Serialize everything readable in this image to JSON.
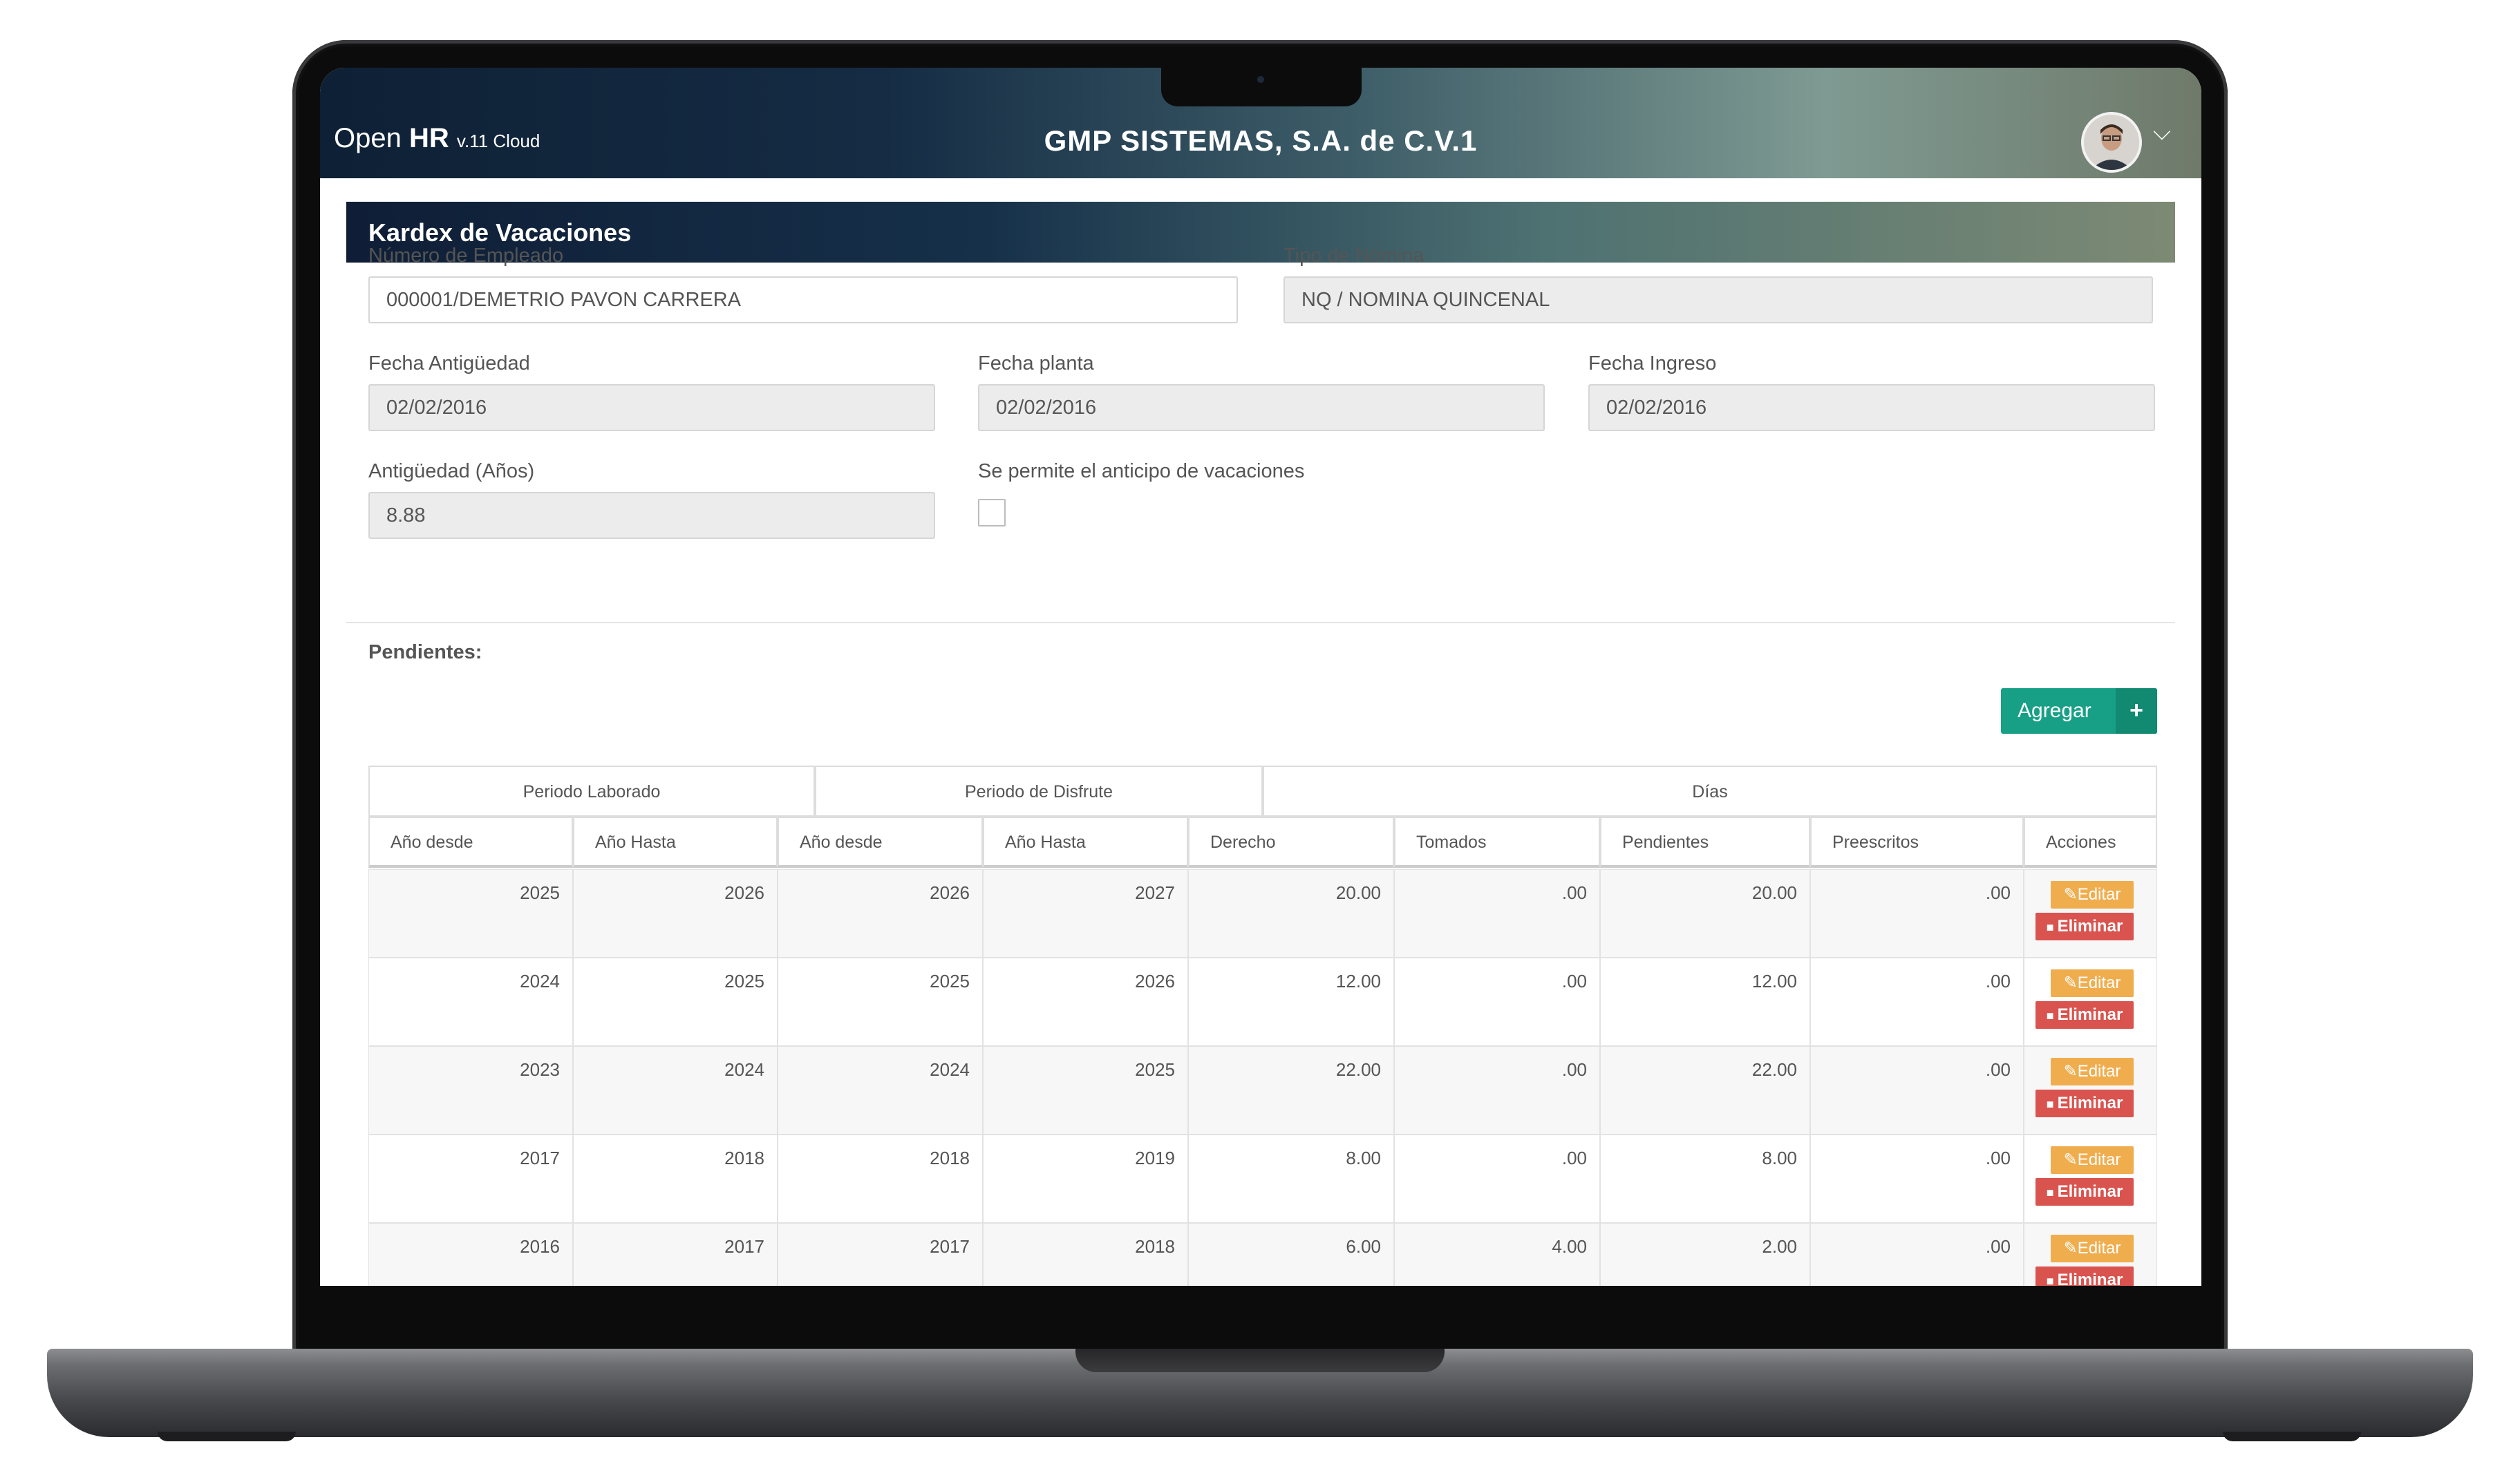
{
  "app": {
    "brand_open": "Open",
    "brand_hr": "HR",
    "brand_version": "v.11 Cloud",
    "company": "GMP SISTEMAS, S.A. de C.V.1"
  },
  "panel": {
    "title": "Kardex de Vacaciones"
  },
  "form": {
    "employee_label": "Número de Empleado",
    "employee_value": "000001/DEMETRIO PAVON CARRERA",
    "payroll_label": "Tipo de Nómina",
    "payroll_value": "NQ / NOMINA QUINCENAL",
    "seniority_date_label": "Fecha Antigüedad",
    "seniority_date_value": "02/02/2016",
    "plant_date_label": "Fecha planta",
    "plant_date_value": "02/02/2016",
    "hire_date_label": "Fecha Ingreso",
    "hire_date_value": "02/02/2016",
    "seniority_years_label": "Antigüedad (Años)",
    "seniority_years_value": "8.88",
    "advance_label": "Se permite el anticipo de vacaciones",
    "advance_checked": false
  },
  "pending": {
    "label": "Pendientes:",
    "add_button": "Agregar",
    "add_icon": "+"
  },
  "table": {
    "groups": [
      "Periodo Laborado",
      "Periodo de Disfrute",
      "Días"
    ],
    "columns": [
      "Año desde",
      "Año Hasta",
      "Año desde",
      "Año Hasta",
      "Derecho",
      "Tomados",
      "Pendientes",
      "Preescritos",
      "Acciones"
    ],
    "rows": [
      [
        "2025",
        "2026",
        "2026",
        "2027",
        "20.00",
        ".00",
        "20.00",
        ".00"
      ],
      [
        "2024",
        "2025",
        "2025",
        "2026",
        "12.00",
        ".00",
        "12.00",
        ".00"
      ],
      [
        "2023",
        "2024",
        "2024",
        "2025",
        "22.00",
        ".00",
        "22.00",
        ".00"
      ],
      [
        "2017",
        "2018",
        "2018",
        "2019",
        "8.00",
        ".00",
        "8.00",
        ".00"
      ],
      [
        "2016",
        "2017",
        "2017",
        "2018",
        "6.00",
        "4.00",
        "2.00",
        ".00"
      ]
    ],
    "edit_label": "Editar",
    "delete_label": "Eliminar",
    "edit_icon": "pencil-square-icon",
    "delete_icon": "trash-icon"
  },
  "colors": {
    "accent_green": "#17a086",
    "edit_orange": "#f0ad4e",
    "delete_red": "#d9534f",
    "header_dark": "#0e2035"
  }
}
